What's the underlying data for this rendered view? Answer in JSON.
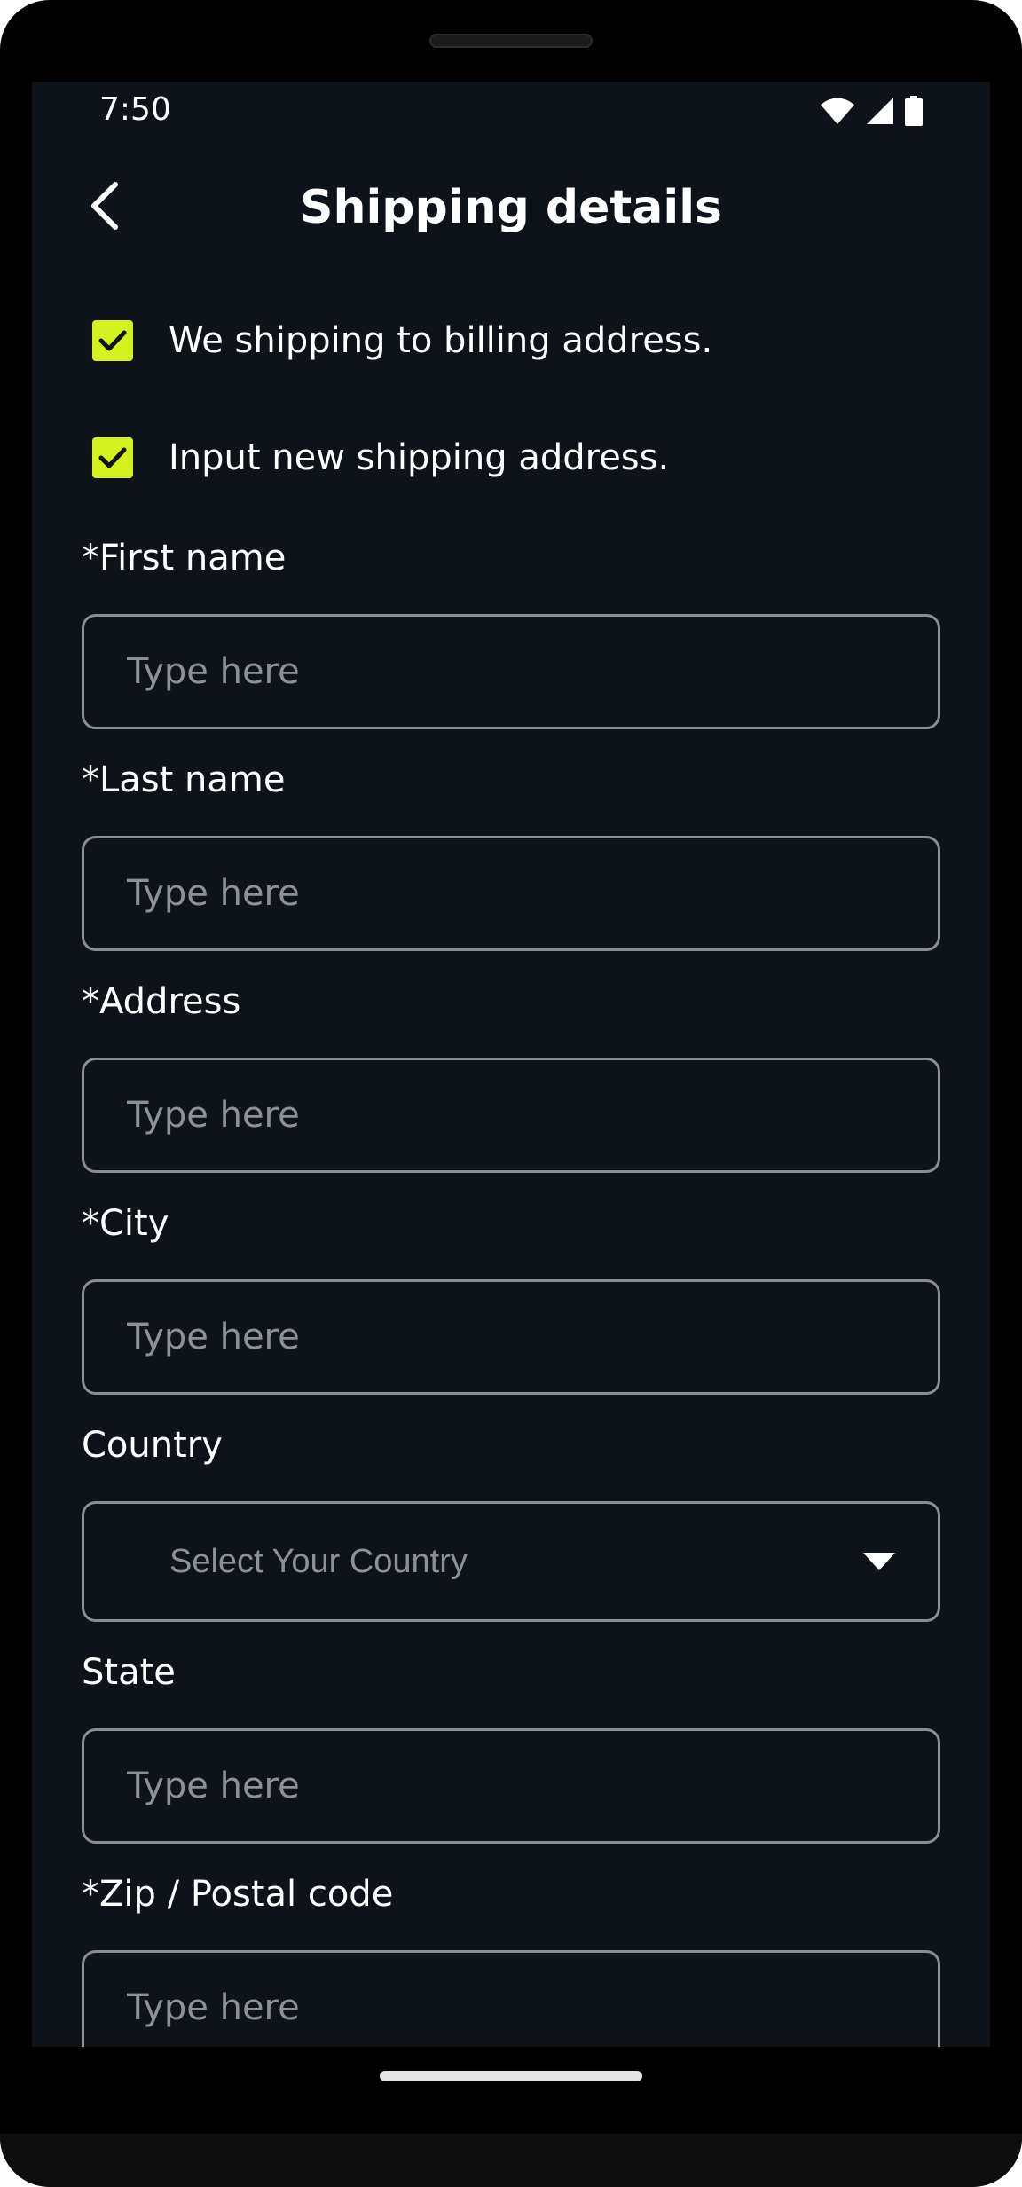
{
  "status_bar": {
    "time": "7:50",
    "icons": [
      "wifi-icon",
      "signal-icon",
      "battery-icon"
    ]
  },
  "header": {
    "title": "Shipping details",
    "back_icon": "chevron-left-icon"
  },
  "options": [
    {
      "label": "We shipping to billing address.",
      "checked": true
    },
    {
      "label": "Input new shipping address.",
      "checked": true
    }
  ],
  "fields": {
    "first_name": {
      "label": "*First name",
      "placeholder": "Type here"
    },
    "last_name": {
      "label": "*Last name",
      "placeholder": "Type here"
    },
    "address": {
      "label": "*Address",
      "placeholder": "Type here"
    },
    "city": {
      "label": "*City",
      "placeholder": "Type here"
    },
    "country": {
      "label": "Country",
      "selected": "Select Your Country",
      "icon": "caret-down-icon"
    },
    "state": {
      "label": "State",
      "placeholder": "Type here"
    },
    "zip": {
      "label": "*Zip / Postal code",
      "placeholder": "Type here"
    }
  },
  "colors": {
    "background": "#0d1318",
    "accent": "#d4f21d",
    "text": "#ffffff",
    "placeholder": "#8d9194",
    "border": "#8a8e91"
  }
}
